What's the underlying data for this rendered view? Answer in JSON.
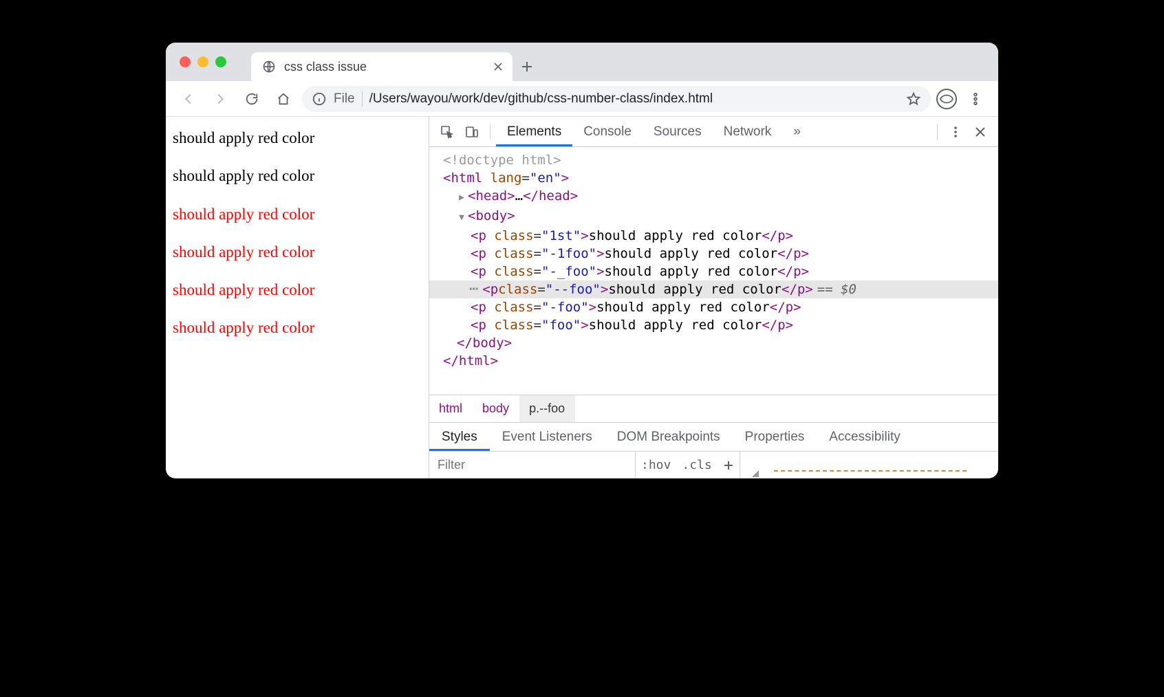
{
  "tab": {
    "title": "css class issue"
  },
  "omnibox": {
    "scheme": "File",
    "path": "/Users/wayou/work/dev/github/css-number-class/index.html"
  },
  "page_paragraphs": [
    {
      "text": "should apply red color",
      "red": false
    },
    {
      "text": "should apply red color",
      "red": false
    },
    {
      "text": "should apply red color",
      "red": true
    },
    {
      "text": "should apply red color",
      "red": true
    },
    {
      "text": "should apply red color",
      "red": true
    },
    {
      "text": "should apply red color",
      "red": true
    }
  ],
  "devtools": {
    "tabs": [
      "Elements",
      "Console",
      "Sources",
      "Network"
    ],
    "active_tab": "Elements",
    "overflow_icon": "»",
    "dom": {
      "doctype": "<!doctype html>",
      "html_open": {
        "tag": "html",
        "attr": "lang",
        "val": "en"
      },
      "head": {
        "open": "head",
        "ellipsis": "…",
        "close": "head"
      },
      "body_tag": "body",
      "paragraphs": [
        {
          "class": "1st",
          "text": "should apply red color"
        },
        {
          "class": "-1foo",
          "text": "should apply red color"
        },
        {
          "class": "-_foo",
          "text": "should apply red color"
        },
        {
          "class": "--foo",
          "text": "should apply red color",
          "selected": true,
          "suffix": "== $0"
        },
        {
          "class": "-foo",
          "text": "should apply red color"
        },
        {
          "class": "foo",
          "text": "should apply red color"
        }
      ],
      "body_close": "body",
      "html_close": "html"
    },
    "breadcrumbs": [
      "html",
      "body",
      "p.--foo"
    ],
    "subtabs": [
      "Styles",
      "Event Listeners",
      "DOM Breakpoints",
      "Properties",
      "Accessibility"
    ],
    "active_subtab": "Styles",
    "filter": {
      "placeholder": "Filter",
      "hov": ":hov",
      "cls": ".cls"
    }
  }
}
